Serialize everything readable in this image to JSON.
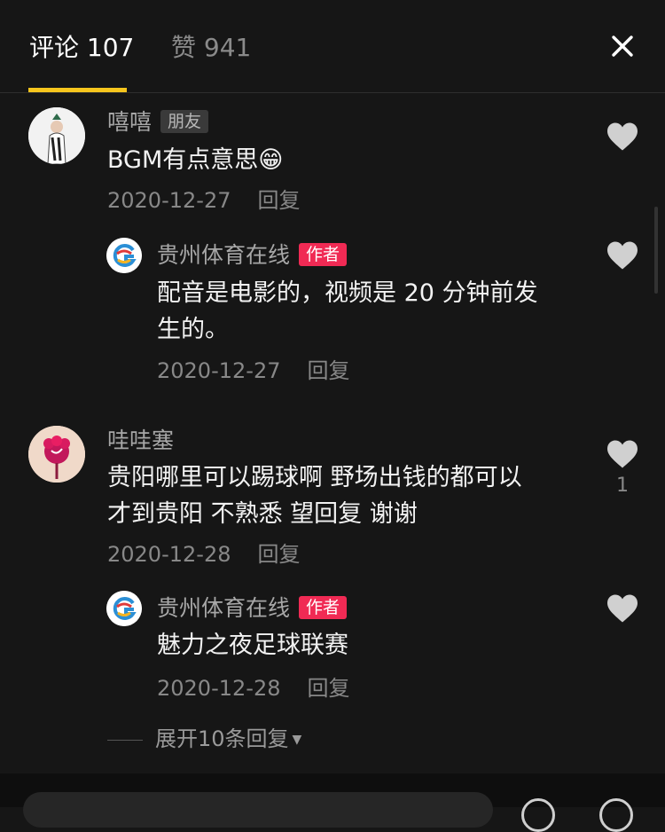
{
  "tabs": {
    "comments": "评论 107",
    "likes": "赞 941"
  },
  "comments": [
    {
      "name": "嘻嘻",
      "badge": "朋友",
      "text": "BGM有点意思😁",
      "date": "2020-12-27",
      "reply_label": "回复",
      "replies": [
        {
          "name": "贵州体育在线",
          "badge": "作者",
          "text_line1": "配音是电影的，视频是 20 分钟前发",
          "text_line2": "生的。",
          "date": "2020-12-27",
          "reply_label": "回复"
        }
      ]
    },
    {
      "name": "哇哇塞",
      "text_line1": "贵阳哪里可以踢球啊 野场出钱的都可以",
      "text_line2": "才到贵阳 不熟悉 望回复 谢谢",
      "date": "2020-12-28",
      "reply_label": "回复",
      "likes": "1",
      "replies": [
        {
          "name": "贵州体育在线",
          "badge": "作者",
          "text": "魅力之夜足球联赛",
          "date": "2020-12-28",
          "reply_label": "回复"
        }
      ],
      "expand_label": "展开10条回复"
    }
  ],
  "colors": {
    "background": "#161616",
    "accent": "#f6c51d",
    "author_badge": "#f02a54"
  }
}
